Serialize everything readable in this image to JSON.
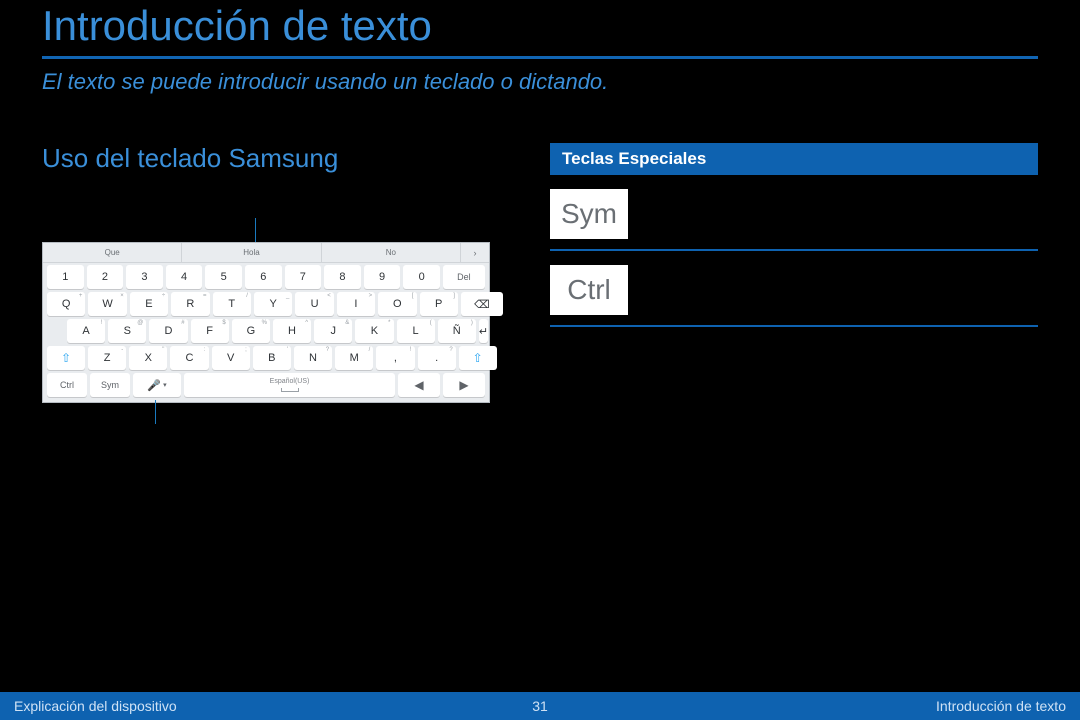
{
  "title": "Introducción de texto",
  "subtitle": "El texto se puede introducir usando un teclado o dictando.",
  "section": "Uso del teclado Samsung",
  "predictive": [
    "Que",
    "Hola",
    "No"
  ],
  "num_row": [
    "1",
    "2",
    "3",
    "4",
    "5",
    "6",
    "7",
    "8",
    "9",
    "0"
  ],
  "del_label": "Del",
  "row_q": [
    "Q",
    "W",
    "E",
    "R",
    "T",
    "Y",
    "U",
    "I",
    "O",
    "P"
  ],
  "row_q_sup": [
    "+",
    "×",
    "÷",
    "=",
    "/",
    "_",
    "<",
    ">",
    "[",
    "]"
  ],
  "row_a": [
    "A",
    "S",
    "D",
    "F",
    "G",
    "H",
    "J",
    "K",
    "L",
    "Ñ"
  ],
  "row_a_sup": [
    "!",
    "@",
    "#",
    "$",
    "%",
    "^",
    "&",
    "*",
    "(",
    ")"
  ],
  "row_z": [
    "Z",
    "X",
    "C",
    "V",
    "B",
    "N",
    "M"
  ],
  "row_z_sup": [
    "-",
    "\"",
    ":",
    ";",
    "'",
    "?",
    "/"
  ],
  "punct1": {
    "main": ",",
    "sup": "!"
  },
  "punct2": {
    "main": ".",
    "sup": "?"
  },
  "bottom": {
    "ctrl": "Ctrl",
    "sym": "Sym",
    "lang": "Español(US)"
  },
  "special_header": "Teclas Especiales",
  "specials": [
    {
      "key": "Sym",
      "desc": ""
    },
    {
      "key": "Ctrl",
      "desc": ""
    }
  ],
  "footer": {
    "left": "Explicación del dispositivo",
    "page": "31",
    "right": "Introducción de texto"
  }
}
